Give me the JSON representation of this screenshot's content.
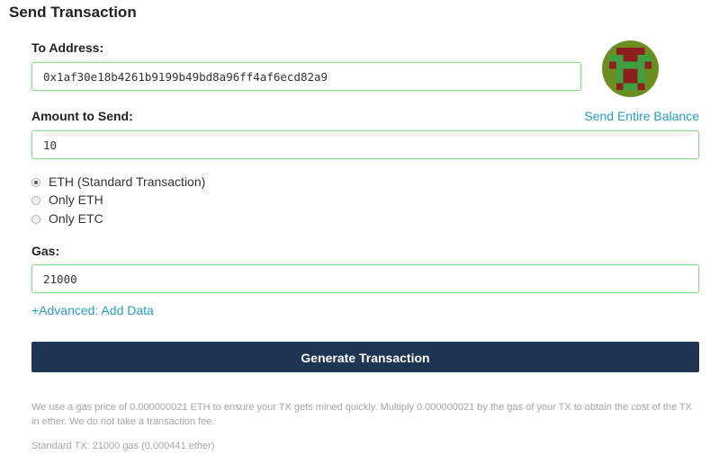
{
  "page": {
    "title": "Send Transaction"
  },
  "to_address": {
    "label": "To Address:",
    "value": "0x1af30e18b4261b9199b49bd8a96ff4af6ecd82a9",
    "avatar_icon": "identicon-avatar",
    "avatar_colors": {
      "bg": "#6b8e23",
      "primary": "#8e1f1f",
      "secondary": "#3fa03f"
    }
  },
  "amount": {
    "label": "Amount to Send:",
    "value": "10",
    "send_entire_balance": "Send Entire Balance"
  },
  "tx_type": {
    "options": [
      {
        "label": "ETH (Standard Transaction)",
        "checked": true
      },
      {
        "label": "Only ETH",
        "checked": false
      },
      {
        "label": "Only ETC",
        "checked": false
      }
    ]
  },
  "gas": {
    "label": "Gas:",
    "value": "21000"
  },
  "advanced_link": "+Advanced: Add Data",
  "generate_button": "Generate Transaction",
  "notes": {
    "gas_price": "We use a gas price of 0.000000021 ETH to ensure your TX gets mined quickly. Multiply 0.000000021 by the gas of your TX to obtain the cost of the TX in ether. We do not take a transaction fee.",
    "standard_tx": "Standard TX: 21000 gas (0.000441 ether)"
  },
  "colors": {
    "accent_link": "#2c9bc1",
    "button_bg": "#1e3553",
    "field_border": "#8fd58f"
  }
}
